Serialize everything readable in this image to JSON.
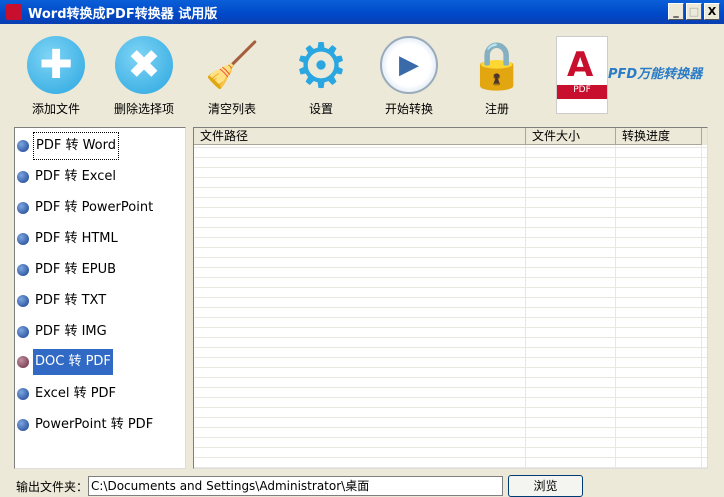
{
  "window": {
    "title": "Word转换成PDF转换器 试用版",
    "minimize": "_",
    "maximize": "□",
    "close": "X"
  },
  "toolbar": [
    {
      "label": "添加文件",
      "icon": "plus-icon",
      "glyph": "✚"
    },
    {
      "label": "删除选择项",
      "icon": "delete-icon",
      "glyph": "✖"
    },
    {
      "label": "清空列表",
      "icon": "broom-icon",
      "glyph": "🧹"
    },
    {
      "label": "设置",
      "icon": "gear-icon",
      "glyph": "⚙"
    },
    {
      "label": "开始转换",
      "icon": "play-icon",
      "glyph": "▶"
    },
    {
      "label": "注册",
      "icon": "lock-icon",
      "glyph": "🔒"
    }
  ],
  "logo": {
    "pdf": "PDF",
    "brand": "PFD万能转换器"
  },
  "modes": [
    "PDF 转 Word",
    "PDF 转 Excel",
    "PDF 转 PowerPoint",
    "PDF 转 HTML",
    "PDF 转 EPUB",
    "PDF 转 TXT",
    "PDF 转 IMG",
    "DOC 转 PDF",
    "Excel 转 PDF",
    "PowerPoint 转 PDF"
  ],
  "list": {
    "columns": [
      "文件路径",
      "文件大小",
      "转换进度"
    ]
  },
  "output": {
    "label": "输出文件夹：",
    "value": "C:\\Documents and Settings\\Administrator\\桌面",
    "browse": "浏览"
  }
}
